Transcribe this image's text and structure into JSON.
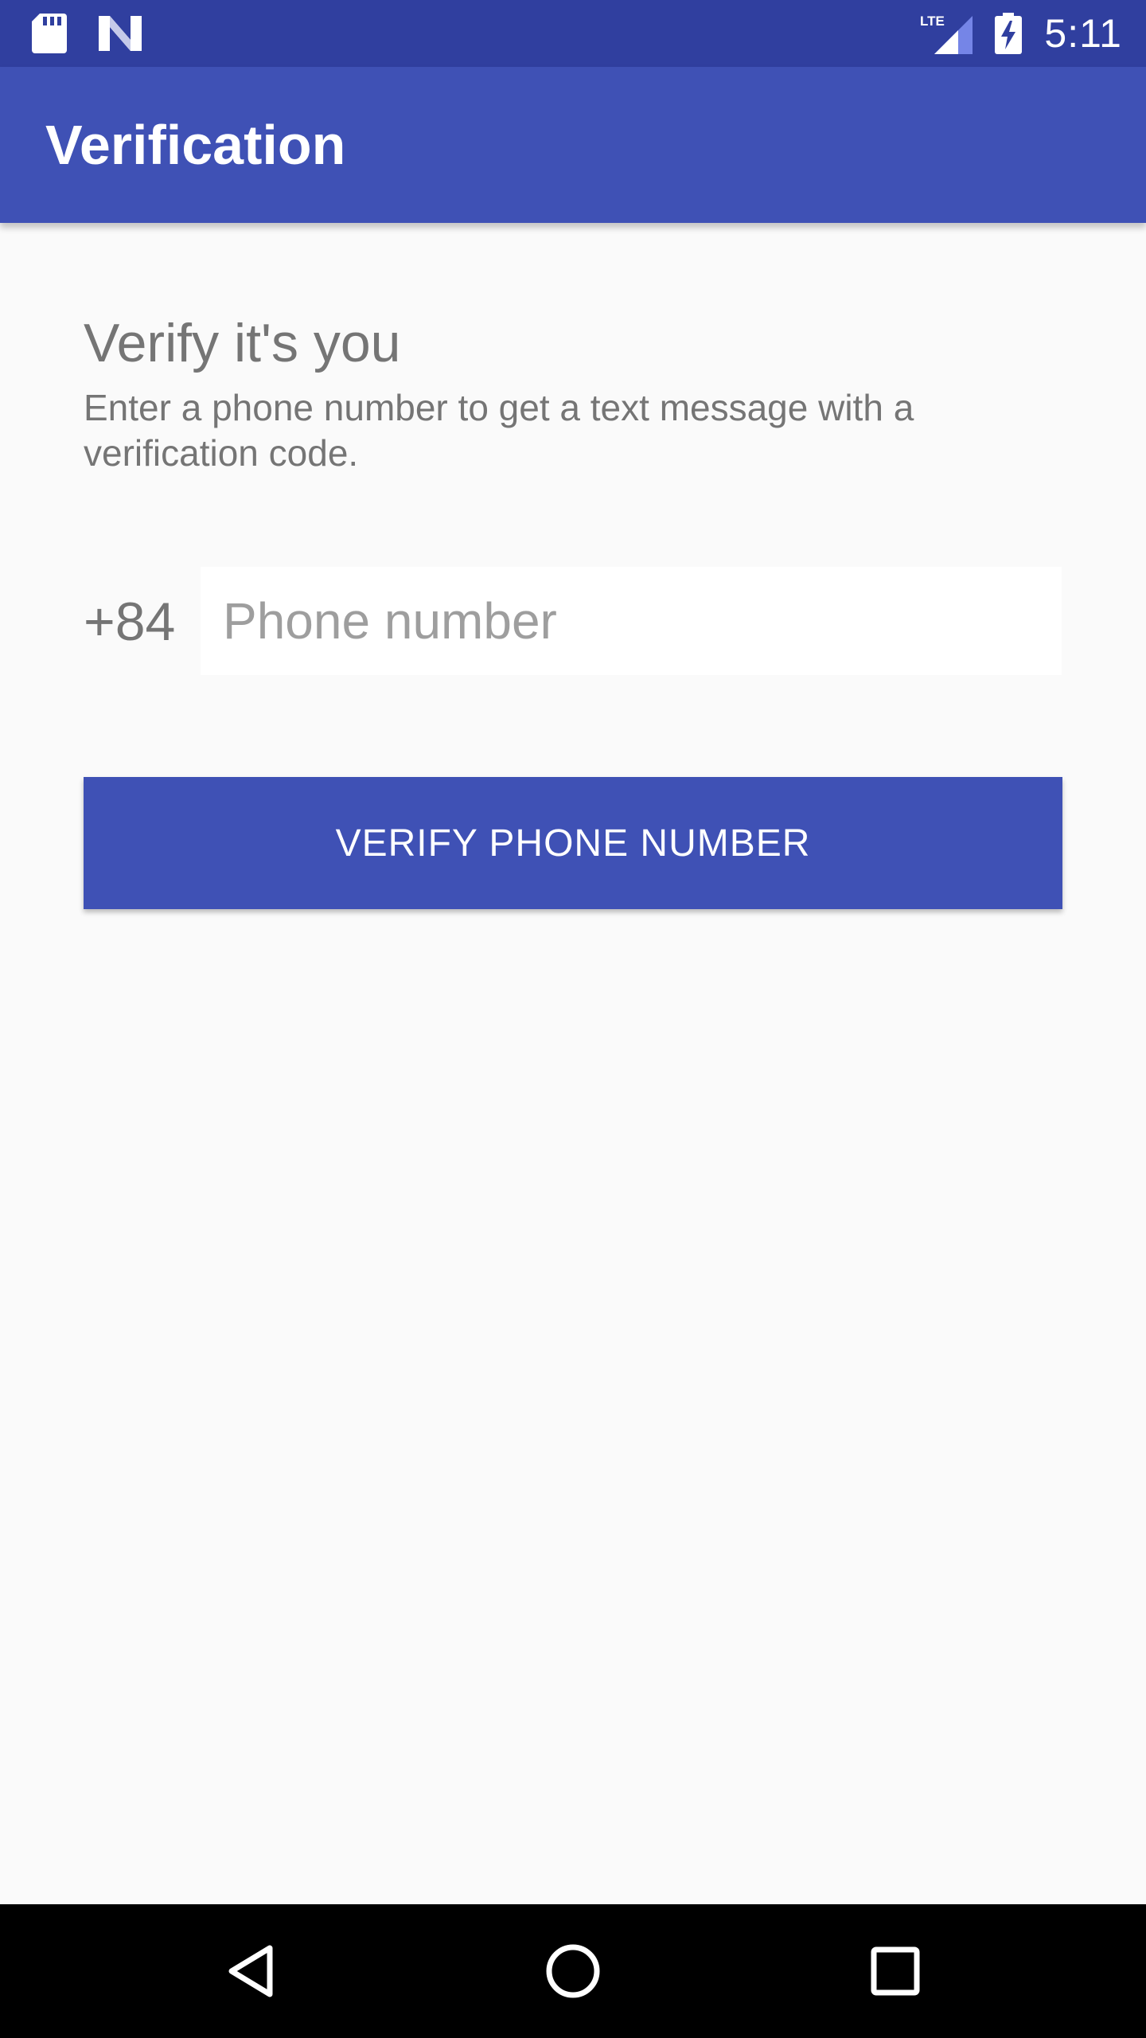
{
  "status_bar": {
    "time": "5:11",
    "network_label": "LTE",
    "icons": [
      "sd-card-icon",
      "n-logo-icon",
      "lte-signal-icon",
      "battery-charging-icon"
    ]
  },
  "app_bar": {
    "title": "Verification"
  },
  "main": {
    "heading": "Verify it's you",
    "description": "Enter a phone number to get a text message with a verification code.",
    "country_code": "+84",
    "phone_input": {
      "value": "",
      "placeholder": "Phone number"
    },
    "verify_button_label": "VERIFY PHONE NUMBER"
  },
  "nav_bar": {
    "icons": [
      "back-icon",
      "home-icon",
      "recents-icon"
    ]
  },
  "colors": {
    "status_bar": "#303f9f",
    "primary": "#3f51b5",
    "background": "#fafafa",
    "text_secondary": "#757575",
    "nav_bar": "#000000"
  }
}
